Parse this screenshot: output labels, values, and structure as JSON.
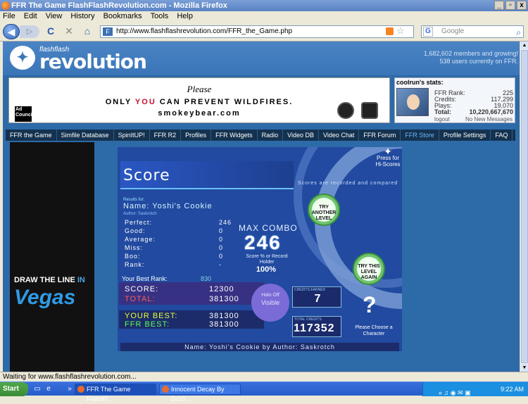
{
  "window": {
    "title": "FFR The Game FlashFlashRevolution.com - Mozilla Firefox",
    "min": "_",
    "max": "▫",
    "close": "x"
  },
  "menu": [
    "File",
    "Edit",
    "View",
    "History",
    "Bookmarks",
    "Tools",
    "Help"
  ],
  "toolbar": {
    "back": "◀",
    "forward": "▷",
    "reload": "C",
    "stop": "✕",
    "home": "⌂",
    "url": "http://www.flashflashrevolution.com/FFR_the_Game.php",
    "search_placeholder": "Google"
  },
  "site": {
    "logo_small": "flashflash",
    "logo_big": "revolution",
    "members": "1,682,602 members and growing!",
    "users": "538 users currently on FFR."
  },
  "ad": {
    "please": "Please",
    "prevent_a": "ONLY ",
    "you": "YOU",
    "prevent_b": " CAN PREVENT WILDFIRES.",
    "url": "smokeybear.com",
    "adc": "Ad Council"
  },
  "user": {
    "title": "coolrun's stats:",
    "stats": [
      {
        "label": "FFR Rank:",
        "value": "225"
      },
      {
        "label": "Credits:",
        "value": "117,299"
      },
      {
        "label": "Plays:",
        "value": "19,070"
      },
      {
        "label": "Total:",
        "value": "10,220,667,670"
      }
    ],
    "logout": "logout",
    "messages": "No New Messages"
  },
  "nav": [
    "FFR the Game",
    "Simfile Database",
    "SpinItUP!",
    "FFR R2",
    "Profiles",
    "FFR Widgets",
    "Radio",
    "Video DB",
    "Video Chat",
    "FFR Forum",
    "FFR Store",
    "Profile Settings",
    "FAQ"
  ],
  "left_ad": {
    "line1a": "DRAW THE LINE ",
    "line1b": "IN",
    "line2": "Vegas"
  },
  "game": {
    "title": "Score",
    "press": "Press for Hi-Scores",
    "recorded": "Scores are recorded and compared",
    "try_another": "TRY ANOTHER LEVEL",
    "try_again": "TRY THIS LEVEL AGAIN",
    "results_for": "Results for:",
    "name": "Name: Yoshi's Cookie",
    "author": "Author: Saskrotch",
    "stats": [
      {
        "label": "Perfect:",
        "value": "246"
      },
      {
        "label": "Good:",
        "value": "0"
      },
      {
        "label": "Average:",
        "value": "0"
      },
      {
        "label": "Miss:",
        "value": "0"
      },
      {
        "label": "Boo:",
        "value": "0"
      },
      {
        "label": "Rank:",
        "value": "-"
      }
    ],
    "max_combo_label": "MAX COMBO",
    "max_combo": "246",
    "score_pct_label": "Score % or Record Holder",
    "score_pct": "100%",
    "best_rank_label": "Your Best Rank:",
    "best_rank": "830",
    "score_label": "SCORE:",
    "score": "12300",
    "total_label": "TOTAL:",
    "total": "381300",
    "your_best_label": "YOUR BEST:",
    "your_best": "381300",
    "ffr_best_label": "FFR BEST:",
    "ffr_best": "381300",
    "visible_off": "Halo Off",
    "visible": "Visible",
    "credits_earned_label": "CREDITS EARNED",
    "credits_earned": "7",
    "total_credits_label": "TOTAL CREDITS",
    "total_credits": "117352",
    "choose": "Please Choose a Character",
    "qmark": "?",
    "footer": "Name: Yoshi's Cookie by Author: Saskrotch"
  },
  "status": "Waiting for www.flashflashrevolution.com...",
  "taskbar": {
    "start": "Start",
    "tasks": [
      "FFR The Game FlashFl...",
      "Innocent Decay By Dr10..."
    ],
    "time": "9:22 AM"
  }
}
